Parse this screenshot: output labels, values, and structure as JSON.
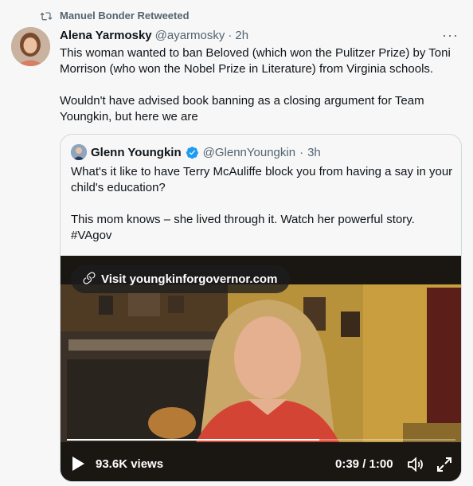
{
  "retweet": {
    "label": "Manuel Bonder Retweeted"
  },
  "tweet": {
    "name": "Alena Yarmosky",
    "handle": "@ayarmosky",
    "separator": "·",
    "time": "2h",
    "more": "···",
    "text": "This woman wanted to ban Beloved (which won the Pulitzer Prize) by Toni Morrison (who won the Nobel Prize in Literature) from Virginia schools.\n\nWouldn't have advised book banning as a closing argument for Team Youngkin, but here we are"
  },
  "quote": {
    "name": "Glenn Youngkin",
    "handle": "@GlennYoungkin",
    "separator": "·",
    "time": "3h",
    "text": "What's it like to have Terry McAuliffe block you from having a say in your child's education?\n\nThis mom knows – she lived through it. Watch her powerful story. #VAgov"
  },
  "video": {
    "link_label": "Visit youngkinforgovernor.com",
    "views": "93.6K views",
    "time": "0:39 / 1:00",
    "progress": 0.65
  },
  "icons": {
    "retweet": "retweet-icon",
    "link": "link-icon",
    "play": "play-icon",
    "volume": "volume-icon",
    "fullscreen": "fullscreen-icon",
    "verified": "verified-badge-icon"
  },
  "colors": {
    "muted": "#536471",
    "verified": "#1d9bf0",
    "border": "#cfd9de"
  }
}
